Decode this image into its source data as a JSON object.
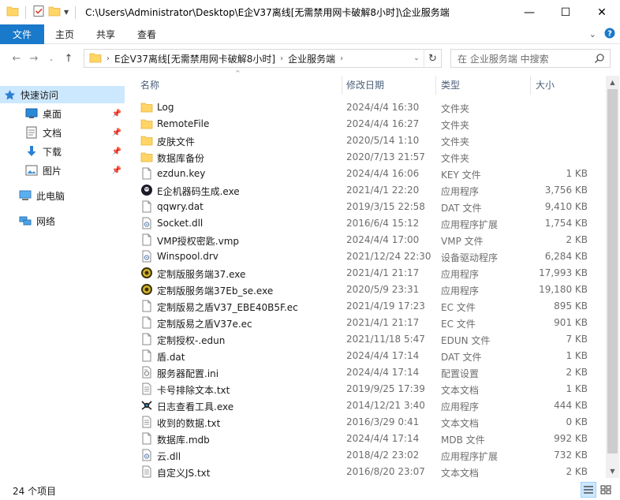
{
  "window": {
    "title": "C:\\Users\\Administrator\\Desktop\\E企V37离线[无需禁用网卡破解8小时]\\企业服务端",
    "controls": {
      "minimize": "—",
      "maximize": "☐",
      "close": "✕"
    }
  },
  "ribbon": {
    "tabs": [
      "文件",
      "主页",
      "共享",
      "查看"
    ]
  },
  "address": {
    "crumbs": [
      "E企V37离线[无需禁用网卡破解8小时]",
      "企业服务端"
    ],
    "search_placeholder": "在 企业服务端 中搜索"
  },
  "nav": {
    "quick_access": "快速访问",
    "items": [
      {
        "label": "桌面",
        "icon": "desktop-icon",
        "pinned": true
      },
      {
        "label": "文档",
        "icon": "document-icon",
        "pinned": true
      },
      {
        "label": "下载",
        "icon": "download-icon",
        "pinned": true
      },
      {
        "label": "图片",
        "icon": "picture-icon",
        "pinned": true
      }
    ],
    "this_pc": "此电脑",
    "network": "网络"
  },
  "columns": {
    "name": "名称",
    "date": "修改日期",
    "type": "类型",
    "size": "大小"
  },
  "files": [
    {
      "name": "Log",
      "date": "2024/4/4 16:30",
      "type": "文件夹",
      "size": "",
      "icon": "folder"
    },
    {
      "name": "RemoteFile",
      "date": "2024/4/4 16:27",
      "type": "文件夹",
      "size": "",
      "icon": "folder"
    },
    {
      "name": "皮肤文件",
      "date": "2020/5/14 1:10",
      "type": "文件夹",
      "size": "",
      "icon": "folder"
    },
    {
      "name": "数据库备份",
      "date": "2020/7/13 21:57",
      "type": "文件夹",
      "size": "",
      "icon": "folder"
    },
    {
      "name": "ezdun.key",
      "date": "2024/4/4 16:06",
      "type": "KEY 文件",
      "size": "1 KB",
      "icon": "file"
    },
    {
      "name": "E企机器码生成.exe",
      "date": "2021/4/1 22:20",
      "type": "应用程序",
      "size": "3,756 KB",
      "icon": "exe-dark"
    },
    {
      "name": "qqwry.dat",
      "date": "2019/3/15 22:58",
      "type": "DAT 文件",
      "size": "9,410 KB",
      "icon": "file"
    },
    {
      "name": "Socket.dll",
      "date": "2016/6/4 15:12",
      "type": "应用程序扩展",
      "size": "1,754 KB",
      "icon": "dll"
    },
    {
      "name": "VMP授权密匙.vmp",
      "date": "2024/4/4 17:00",
      "type": "VMP 文件",
      "size": "2 KB",
      "icon": "file"
    },
    {
      "name": "Winspool.drv",
      "date": "2021/12/24 22:30",
      "type": "设备驱动程序",
      "size": "6,284 KB",
      "icon": "dll"
    },
    {
      "name": "定制版服务端37.exe",
      "date": "2021/4/1 21:17",
      "type": "应用程序",
      "size": "17,993 KB",
      "icon": "exe-gold"
    },
    {
      "name": "定制版服务端37Eb_se.exe",
      "date": "2020/5/9 23:31",
      "type": "应用程序",
      "size": "19,180 KB",
      "icon": "exe-gold"
    },
    {
      "name": "定制版易之盾V37_EBE40B5F.ec",
      "date": "2021/4/19 17:23",
      "type": "EC 文件",
      "size": "895 KB",
      "icon": "file"
    },
    {
      "name": "定制版易之盾V37e.ec",
      "date": "2021/4/1 21:17",
      "type": "EC 文件",
      "size": "901 KB",
      "icon": "file"
    },
    {
      "name": "定制授权-.edun",
      "date": "2021/11/18 5:47",
      "type": "EDUN 文件",
      "size": "7 KB",
      "icon": "file"
    },
    {
      "name": "盾.dat",
      "date": "2024/4/4 17:14",
      "type": "DAT 文件",
      "size": "1 KB",
      "icon": "file"
    },
    {
      "name": "服务器配置.ini",
      "date": "2024/4/4 17:14",
      "type": "配置设置",
      "size": "2 KB",
      "icon": "ini"
    },
    {
      "name": "卡号排除文本.txt",
      "date": "2019/9/25 17:39",
      "type": "文本文档",
      "size": "1 KB",
      "icon": "txt"
    },
    {
      "name": "日志查看工具.exe",
      "date": "2014/12/21 3:40",
      "type": "应用程序",
      "size": "444 KB",
      "icon": "exe-bug"
    },
    {
      "name": "收到的数据.txt",
      "date": "2016/3/29 0:41",
      "type": "文本文档",
      "size": "0 KB",
      "icon": "txt"
    },
    {
      "name": "数据库.mdb",
      "date": "2024/4/4 17:14",
      "type": "MDB 文件",
      "size": "992 KB",
      "icon": "file"
    },
    {
      "name": "云.dll",
      "date": "2018/4/2 23:02",
      "type": "应用程序扩展",
      "size": "732 KB",
      "icon": "dll"
    },
    {
      "name": "自定义JS.txt",
      "date": "2016/8/20 23:07",
      "type": "文本文档",
      "size": "2 KB",
      "icon": "txt"
    }
  ],
  "status": {
    "count": "24 个项目"
  },
  "colors": {
    "accent": "#1979ca",
    "selected": "#cce8ff",
    "folder": "#ffd566",
    "folder_dark": "#e6b33c"
  }
}
